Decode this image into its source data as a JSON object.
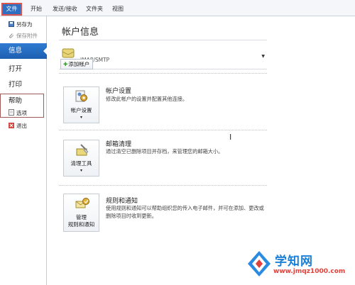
{
  "ribbon": {
    "tabs": [
      {
        "label": "文件"
      },
      {
        "label": "开始"
      },
      {
        "label": "发送/接收"
      },
      {
        "label": "文件夹"
      },
      {
        "label": "视图"
      }
    ]
  },
  "nav": {
    "save_as": "另存为",
    "save_attachment": "保存附件",
    "info": "信息",
    "open": "打开",
    "print": "打印",
    "help": "帮助",
    "options": "选项",
    "exit": "退出"
  },
  "main": {
    "title": "帐户信息",
    "account_name": "IMAP/SMTP",
    "add_account": "添加帐户",
    "sections": [
      {
        "button": "帐户设置",
        "title": "帐户设置",
        "desc": "修改此帐户的设置并配置其他连接。"
      },
      {
        "button": "清理工具",
        "title": "邮箱清理",
        "desc": "通过清空已删除项目并存档，来管理您的邮箱大小。"
      },
      {
        "button_line1": "管理",
        "button_line2": "规则和通知",
        "title": "规则和通知",
        "desc": "使用规则和通知可以帮助组织您的传入电子邮件，并可在添加、更改或删除项目时收到更新。"
      }
    ]
  },
  "watermark": {
    "title": "学知网",
    "url": "www.jmqz1000.com"
  },
  "colors": {
    "accent": "#2f6fc0",
    "nav_active": "#2f7bd2",
    "highlight_border": "#d9534f",
    "watermark_blue": "#1a7fd6",
    "watermark_red": "#e0423b"
  }
}
